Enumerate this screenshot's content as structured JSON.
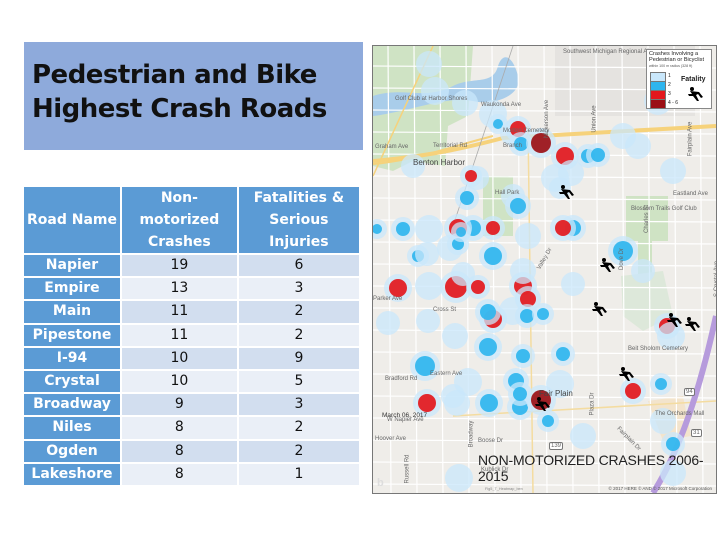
{
  "title": {
    "line1": "Pedestrian and Bike",
    "line2": "Highest Crash Roads"
  },
  "table": {
    "headers": [
      "Road Name",
      "Non-motorized Crashes",
      "Fatalities & Serious Injuries"
    ],
    "header_lines": {
      "road": [
        "Road Name"
      ],
      "crashes": [
        "Non-",
        "motorized",
        "Crashes"
      ],
      "fatalities": [
        "Fatalities &",
        "Serious Injuries"
      ]
    },
    "rows": [
      {
        "road": "Napier",
        "crashes": "19",
        "fatalities": "6"
      },
      {
        "road": "Empire",
        "crashes": "13",
        "fatalities": "3"
      },
      {
        "road": "Main",
        "crashes": "11",
        "fatalities": "2"
      },
      {
        "road": "Pipestone",
        "crashes": "11",
        "fatalities": "2"
      },
      {
        "road": "I-94",
        "crashes": "10",
        "fatalities": "9"
      },
      {
        "road": "Crystal",
        "crashes": "10",
        "fatalities": "5"
      },
      {
        "road": "Broadway",
        "crashes": "9",
        "fatalities": "3"
      },
      {
        "road": "Niles",
        "crashes": "8",
        "fatalities": "2"
      },
      {
        "road": "Ogden",
        "crashes": "8",
        "fatalities": "2"
      },
      {
        "road": "Lakeshore",
        "crashes": "8",
        "fatalities": "1"
      }
    ]
  },
  "map": {
    "footer_title": "NON-MOTORIZED CRASHES 2006-2015",
    "date": "March 06, 2017",
    "copyright": "© 2017 HERE © AND © 2017 Microsoft Corporation",
    "attribution": "Fig5_T_Heatmap_ben",
    "bing_logo": "b",
    "legend": {
      "title_line1": "Crashes Involving a",
      "title_line2": "Pedestrian or Bicyclist",
      "subtitle": "within 100 m radius (328 ft)",
      "classes": [
        {
          "label": "1",
          "color": "#c9e7fb"
        },
        {
          "label": "2",
          "color": "#2fb5ee"
        },
        {
          "label": "3",
          "color": "#e3171c"
        },
        {
          "label": "4 - 6",
          "color": "#9b0f15"
        }
      ],
      "fatality_label": "Fatality",
      "fatality_icon": "fallen-person-icon"
    },
    "labels": [
      {
        "text": "Southwest Michigan Regional Airport",
        "kind": "small"
      },
      {
        "text": "Golf Club at Harbor Shores",
        "kind": "small"
      },
      {
        "text": "Waukonda Ave",
        "kind": "small"
      },
      {
        "text": "Morton Cemetery",
        "kind": "small"
      },
      {
        "text": "Graham Ave",
        "kind": "small"
      },
      {
        "text": "Territorial Rd",
        "kind": "small"
      },
      {
        "text": "Branch",
        "kind": "small"
      },
      {
        "text": "Benton Harbor",
        "kind": "big"
      },
      {
        "text": "Hall Park",
        "kind": "small"
      },
      {
        "text": "Blossom Trails Golf Club",
        "kind": "small"
      },
      {
        "text": "Eastland Ave",
        "kind": "small"
      },
      {
        "text": "Charles St",
        "kind": "small"
      },
      {
        "text": "Nickerson Ave",
        "kind": "small"
      },
      {
        "text": "Union Ave",
        "kind": "small"
      },
      {
        "text": "Fairplain Ave",
        "kind": "small"
      },
      {
        "text": "S Crystal Ave",
        "kind": "small"
      },
      {
        "text": "Dove Dr",
        "kind": "small"
      },
      {
        "text": "Valley Dr",
        "kind": "small"
      },
      {
        "text": "Parker Ave",
        "kind": "small"
      },
      {
        "text": "Cross St",
        "kind": "small"
      },
      {
        "text": "Beit Sholom Cemetery",
        "kind": "small"
      },
      {
        "text": "Eastern Ave",
        "kind": "small"
      },
      {
        "text": "Bradford Rd",
        "kind": "small"
      },
      {
        "text": "Fair Plain",
        "kind": "big"
      },
      {
        "text": "W Napier Ave",
        "kind": "small"
      },
      {
        "text": "Hoover Ave",
        "kind": "small"
      },
      {
        "text": "Broadway",
        "kind": "small"
      },
      {
        "text": "Boose Dr",
        "kind": "small"
      },
      {
        "text": "Kublick Dr",
        "kind": "small"
      },
      {
        "text": "Russell Rd",
        "kind": "small"
      },
      {
        "text": "Plaza Dr",
        "kind": "small"
      },
      {
        "text": "Fairplain Dr",
        "kind": "small"
      },
      {
        "text": "The Orchards Mall",
        "kind": "small"
      },
      {
        "text": "139",
        "kind": "shield"
      },
      {
        "text": "94",
        "kind": "shield"
      },
      {
        "text": "31",
        "kind": "shield"
      }
    ]
  }
}
